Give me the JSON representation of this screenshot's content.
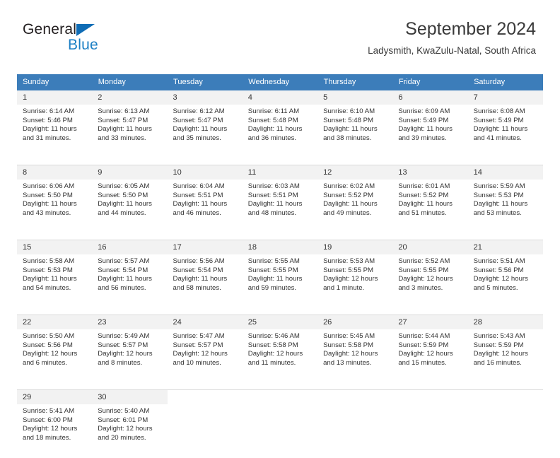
{
  "logo": {
    "word_top": "General",
    "word_bottom": "Blue",
    "triangle_color": "#0f6cb5",
    "blue_color": "#1b7fc4"
  },
  "header": {
    "title": "September 2024",
    "subtitle": "Ladysmith, KwaZulu-Natal, South Africa"
  },
  "colors": {
    "header_bg": "#3c7dba",
    "daynum_bg": "#f2f2f2",
    "text": "#333333"
  },
  "weekdays": [
    "Sunday",
    "Monday",
    "Tuesday",
    "Wednesday",
    "Thursday",
    "Friday",
    "Saturday"
  ],
  "weeks": [
    {
      "days": [
        {
          "num": "1",
          "sunrise": "Sunrise: 6:14 AM",
          "sunset": "Sunset: 5:46 PM",
          "daylight1": "Daylight: 11 hours",
          "daylight2": "and 31 minutes."
        },
        {
          "num": "2",
          "sunrise": "Sunrise: 6:13 AM",
          "sunset": "Sunset: 5:47 PM",
          "daylight1": "Daylight: 11 hours",
          "daylight2": "and 33 minutes."
        },
        {
          "num": "3",
          "sunrise": "Sunrise: 6:12 AM",
          "sunset": "Sunset: 5:47 PM",
          "daylight1": "Daylight: 11 hours",
          "daylight2": "and 35 minutes."
        },
        {
          "num": "4",
          "sunrise": "Sunrise: 6:11 AM",
          "sunset": "Sunset: 5:48 PM",
          "daylight1": "Daylight: 11 hours",
          "daylight2": "and 36 minutes."
        },
        {
          "num": "5",
          "sunrise": "Sunrise: 6:10 AM",
          "sunset": "Sunset: 5:48 PM",
          "daylight1": "Daylight: 11 hours",
          "daylight2": "and 38 minutes."
        },
        {
          "num": "6",
          "sunrise": "Sunrise: 6:09 AM",
          "sunset": "Sunset: 5:49 PM",
          "daylight1": "Daylight: 11 hours",
          "daylight2": "and 39 minutes."
        },
        {
          "num": "7",
          "sunrise": "Sunrise: 6:08 AM",
          "sunset": "Sunset: 5:49 PM",
          "daylight1": "Daylight: 11 hours",
          "daylight2": "and 41 minutes."
        }
      ]
    },
    {
      "days": [
        {
          "num": "8",
          "sunrise": "Sunrise: 6:06 AM",
          "sunset": "Sunset: 5:50 PM",
          "daylight1": "Daylight: 11 hours",
          "daylight2": "and 43 minutes."
        },
        {
          "num": "9",
          "sunrise": "Sunrise: 6:05 AM",
          "sunset": "Sunset: 5:50 PM",
          "daylight1": "Daylight: 11 hours",
          "daylight2": "and 44 minutes."
        },
        {
          "num": "10",
          "sunrise": "Sunrise: 6:04 AM",
          "sunset": "Sunset: 5:51 PM",
          "daylight1": "Daylight: 11 hours",
          "daylight2": "and 46 minutes."
        },
        {
          "num": "11",
          "sunrise": "Sunrise: 6:03 AM",
          "sunset": "Sunset: 5:51 PM",
          "daylight1": "Daylight: 11 hours",
          "daylight2": "and 48 minutes."
        },
        {
          "num": "12",
          "sunrise": "Sunrise: 6:02 AM",
          "sunset": "Sunset: 5:52 PM",
          "daylight1": "Daylight: 11 hours",
          "daylight2": "and 49 minutes."
        },
        {
          "num": "13",
          "sunrise": "Sunrise: 6:01 AM",
          "sunset": "Sunset: 5:52 PM",
          "daylight1": "Daylight: 11 hours",
          "daylight2": "and 51 minutes."
        },
        {
          "num": "14",
          "sunrise": "Sunrise: 5:59 AM",
          "sunset": "Sunset: 5:53 PM",
          "daylight1": "Daylight: 11 hours",
          "daylight2": "and 53 minutes."
        }
      ]
    },
    {
      "days": [
        {
          "num": "15",
          "sunrise": "Sunrise: 5:58 AM",
          "sunset": "Sunset: 5:53 PM",
          "daylight1": "Daylight: 11 hours",
          "daylight2": "and 54 minutes."
        },
        {
          "num": "16",
          "sunrise": "Sunrise: 5:57 AM",
          "sunset": "Sunset: 5:54 PM",
          "daylight1": "Daylight: 11 hours",
          "daylight2": "and 56 minutes."
        },
        {
          "num": "17",
          "sunrise": "Sunrise: 5:56 AM",
          "sunset": "Sunset: 5:54 PM",
          "daylight1": "Daylight: 11 hours",
          "daylight2": "and 58 minutes."
        },
        {
          "num": "18",
          "sunrise": "Sunrise: 5:55 AM",
          "sunset": "Sunset: 5:55 PM",
          "daylight1": "Daylight: 11 hours",
          "daylight2": "and 59 minutes."
        },
        {
          "num": "19",
          "sunrise": "Sunrise: 5:53 AM",
          "sunset": "Sunset: 5:55 PM",
          "daylight1": "Daylight: 12 hours",
          "daylight2": "and 1 minute."
        },
        {
          "num": "20",
          "sunrise": "Sunrise: 5:52 AM",
          "sunset": "Sunset: 5:55 PM",
          "daylight1": "Daylight: 12 hours",
          "daylight2": "and 3 minutes."
        },
        {
          "num": "21",
          "sunrise": "Sunrise: 5:51 AM",
          "sunset": "Sunset: 5:56 PM",
          "daylight1": "Daylight: 12 hours",
          "daylight2": "and 5 minutes."
        }
      ]
    },
    {
      "days": [
        {
          "num": "22",
          "sunrise": "Sunrise: 5:50 AM",
          "sunset": "Sunset: 5:56 PM",
          "daylight1": "Daylight: 12 hours",
          "daylight2": "and 6 minutes."
        },
        {
          "num": "23",
          "sunrise": "Sunrise: 5:49 AM",
          "sunset": "Sunset: 5:57 PM",
          "daylight1": "Daylight: 12 hours",
          "daylight2": "and 8 minutes."
        },
        {
          "num": "24",
          "sunrise": "Sunrise: 5:47 AM",
          "sunset": "Sunset: 5:57 PM",
          "daylight1": "Daylight: 12 hours",
          "daylight2": "and 10 minutes."
        },
        {
          "num": "25",
          "sunrise": "Sunrise: 5:46 AM",
          "sunset": "Sunset: 5:58 PM",
          "daylight1": "Daylight: 12 hours",
          "daylight2": "and 11 minutes."
        },
        {
          "num": "26",
          "sunrise": "Sunrise: 5:45 AM",
          "sunset": "Sunset: 5:58 PM",
          "daylight1": "Daylight: 12 hours",
          "daylight2": "and 13 minutes."
        },
        {
          "num": "27",
          "sunrise": "Sunrise: 5:44 AM",
          "sunset": "Sunset: 5:59 PM",
          "daylight1": "Daylight: 12 hours",
          "daylight2": "and 15 minutes."
        },
        {
          "num": "28",
          "sunrise": "Sunrise: 5:43 AM",
          "sunset": "Sunset: 5:59 PM",
          "daylight1": "Daylight: 12 hours",
          "daylight2": "and 16 minutes."
        }
      ]
    },
    {
      "days": [
        {
          "num": "29",
          "sunrise": "Sunrise: 5:41 AM",
          "sunset": "Sunset: 6:00 PM",
          "daylight1": "Daylight: 12 hours",
          "daylight2": "and 18 minutes."
        },
        {
          "num": "30",
          "sunrise": "Sunrise: 5:40 AM",
          "sunset": "Sunset: 6:01 PM",
          "daylight1": "Daylight: 12 hours",
          "daylight2": "and 20 minutes."
        },
        {
          "num": "",
          "sunrise": "",
          "sunset": "",
          "daylight1": "",
          "daylight2": ""
        },
        {
          "num": "",
          "sunrise": "",
          "sunset": "",
          "daylight1": "",
          "daylight2": ""
        },
        {
          "num": "",
          "sunrise": "",
          "sunset": "",
          "daylight1": "",
          "daylight2": ""
        },
        {
          "num": "",
          "sunrise": "",
          "sunset": "",
          "daylight1": "",
          "daylight2": ""
        },
        {
          "num": "",
          "sunrise": "",
          "sunset": "",
          "daylight1": "",
          "daylight2": ""
        }
      ]
    }
  ]
}
